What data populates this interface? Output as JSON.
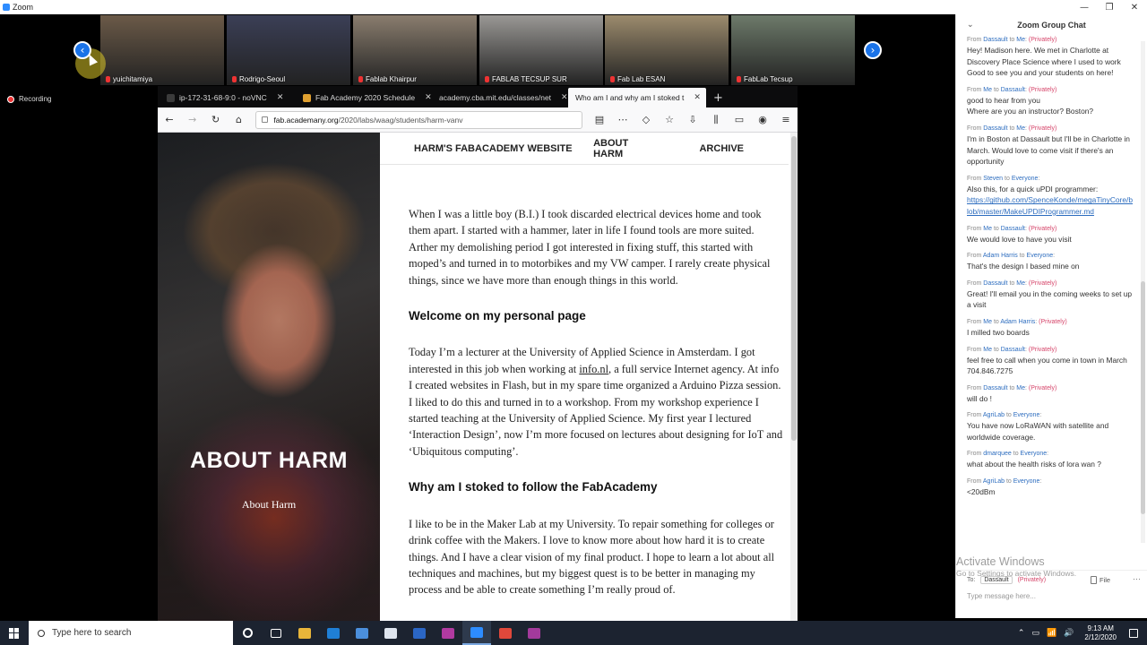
{
  "zoom": {
    "title": "Zoom",
    "window_controls": [
      "—",
      "❐",
      "✕"
    ],
    "recording_label": "Recording",
    "gallery": [
      {
        "name": "yuichitamiya",
        "tone": "#6b5a48"
      },
      {
        "name": "Rodrigo-Seoul",
        "tone": "#3b3f56"
      },
      {
        "name": "Fablab Khairpur",
        "tone": "#8a7d6e"
      },
      {
        "name": "FABLAB TECSUP SUR",
        "tone": "#9a9895"
      },
      {
        "name": "Fab Lab ESAN",
        "tone": "#9c8b6d"
      },
      {
        "name": "FabLab Tecsup",
        "tone": "#6d7a6a"
      }
    ],
    "prev_icon": "‹",
    "next_icon": "›"
  },
  "browser": {
    "tabs": [
      {
        "label": "ip-172-31-68-9:0 - noVNC",
        "fav": "#3b3b3b"
      },
      {
        "label": "Fab Academy 2020 Schedule",
        "fav": "#e0a030"
      },
      {
        "label": "academy.cba.mit.edu/classes/net",
        "fav": "#888888"
      },
      {
        "label": "Who am I and why am I stoked t",
        "fav": "#888888"
      }
    ],
    "new_tab": "+",
    "url_host": "fab.academany.org",
    "url_path": "/2020/labs/waag/students/harm-vanv",
    "nav_icons": {
      "back": "←",
      "forward": "→",
      "reload": "↻",
      "home": "⌂"
    },
    "right_icons": [
      "▤",
      "⋯",
      "◇",
      "☆",
      "⇩",
      "⫼",
      "▭",
      "◉",
      "≡"
    ]
  },
  "site": {
    "nav": {
      "brand": "HARM'S FABACADEMY WEBSITE",
      "about": "ABOUT HARM",
      "archive": "ARCHIVE"
    },
    "hero": {
      "title": "ABOUT HARM",
      "subtitle": "About Harm"
    },
    "content": {
      "p1": "When I was a little boy (B.I.) I took discarded electrical devices home and took them apart. I started with a hammer, later in life I found tools are more suited. Arther my demolishing period I got interested in fixing stuff, this started with moped’s and turned in to motorbikes and my VW camper. I rarely create physical things, since we have more than enough things in this world.",
      "h_welcome": "Welcome on my personal page",
      "p2_before": "Today I’m a lecturer at the University of Applied Science in Amsterdam. I got interested in this job when working at ",
      "p2_link": "info.nl",
      "p2_after": ", a full service Internet agency. At info I created websites in Flash, but in my spare time organized a Arduino Pizza session. I liked to do this and turned in to a workshop. From my workshop experience I started teaching at the University of Applied Science. My first year I lectured ‘Interaction Design’, now I’m more focused on lectures about designing for IoT and ‘Ubiquitous computing’.",
      "h_why": "Why am I stoked to follow the FabAcademy",
      "p3": "I like to be in the Maker Lab at my University. To repair something for colleges or drink coffee with the Makers. I love to know more about how hard it is to create things. And I have a clear vision of my final product. I hope to learn a lot about all techniques and machines, but my biggest quest is to be better in managing my process and be able to create something I’m really proud of."
    }
  },
  "chat": {
    "title": "Zoom Group Chat",
    "collapse_icon": "⌄",
    "messages": [
      {
        "from": "Dassault",
        "to": "Me",
        "priv": "(Privately)",
        "body": "Hey! Madison here. We met in Charlotte at Discovery Place Science where I used to work\nGood to see you and your students on here!"
      },
      {
        "from": "Me",
        "to": "Dassault",
        "priv": "(Privately)",
        "body": "good to hear from you\nWhere are you an instructor?  Boston?"
      },
      {
        "from": "Dassault",
        "to": "Me",
        "priv": "(Privately)",
        "body": "I'm in Boston at Dassault but I'll be in Charlotte in March. Would love to come visit if there's an opportunity"
      },
      {
        "from": "Steven",
        "to": "Everyone",
        "priv": "",
        "body": "Also this, for a quick uPDI programmer:",
        "link": "https://github.com/SpenceKonde/megaTinyCore/blob/master/MakeUPDIProgrammer.md"
      },
      {
        "from": "Me",
        "to": "Dassault",
        "priv": "(Privately)",
        "body": "We would love to have you visit"
      },
      {
        "from": "Adam Harris",
        "to": "Everyone",
        "priv": "",
        "body": "That's the design I based mine on"
      },
      {
        "from": "Dassault",
        "to": "Me",
        "priv": "(Privately)",
        "body": "Great! I'll email you in the coming weeks to set up a visit"
      },
      {
        "from": "Me",
        "to": "Adam Harris",
        "priv": "(Privately)",
        "body": "I milled two boards"
      },
      {
        "from": "Me",
        "to": "Dassault",
        "priv": "(Privately)",
        "body": "feel free to call when you come in town in March 704.846.7275"
      },
      {
        "from": "Dassault",
        "to": "Me",
        "priv": "(Privately)",
        "body": "will do !"
      },
      {
        "from": "AgriLab",
        "to": "Everyone",
        "priv": "",
        "body": "You have now LoRaWAN with satellite and worldwide coverage."
      },
      {
        "from": "dmarquee",
        "to": "Everyone",
        "priv": "",
        "body": "what about the health risks of lora wan ?"
      },
      {
        "from": "AgriLab",
        "to": "Everyone",
        "priv": "",
        "body": "<20dBm"
      }
    ],
    "to_label": "To:",
    "to_value": "Dassault",
    "to_priv": "(Privately)",
    "file_label": "File",
    "more_icon": "⋯",
    "placeholder": "Type message here...",
    "watermark_title": "Activate Windows",
    "watermark_sub": "Go to Settings to activate Windows."
  },
  "taskbar": {
    "search_placeholder": "Type here to search",
    "apps": [
      {
        "name": "file-explorer-icon",
        "color": "#e8b53a"
      },
      {
        "name": "edge-icon",
        "color": "#1f7fd6"
      },
      {
        "name": "store-icon",
        "color": "#4b8fdc"
      },
      {
        "name": "mail-icon",
        "color": "#dfe5ee"
      },
      {
        "name": "word-b-icon",
        "color": "#2b66c4"
      },
      {
        "name": "app-purple-icon",
        "color": "#b03aa0"
      },
      {
        "name": "zoom-icon",
        "color": "#2d8cff"
      },
      {
        "name": "chrome-icon",
        "color": "#e0483b"
      },
      {
        "name": "app-magenta-icon",
        "color": "#a33a9c"
      }
    ],
    "tray_icons": [
      "⌃",
      "▭",
      "📶",
      "🔊"
    ],
    "time": "9:13 AM",
    "date": "2/12/2020"
  }
}
